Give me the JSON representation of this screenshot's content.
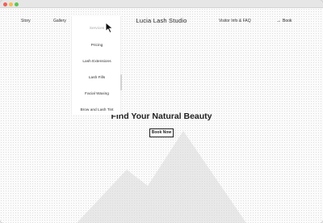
{
  "nav": {
    "story": "Story",
    "gallery": "Gallery",
    "brand": "Lucia Lash Studio",
    "visitor_info": "Visitor Info & FAQ",
    "book": "Book"
  },
  "dropdown": {
    "items": [
      "Services",
      "Pricing",
      "Lash Extensions",
      "Lash Fills",
      "Facial Waxing",
      "Brow and Lash Tint"
    ]
  },
  "hero": {
    "title": "Find  Your Natural Beauty",
    "button": "Book Now"
  },
  "icons": {
    "book_arrow": "arrow-right-icon",
    "cursor": "mouse-pointer-icon",
    "background": "mountain-icon"
  },
  "colors": {
    "accent": "#222222",
    "active_menu": "#a9a9a9",
    "close": "#ee5f57",
    "minimize": "#f5bd4f",
    "maximize": "#5fc454"
  }
}
